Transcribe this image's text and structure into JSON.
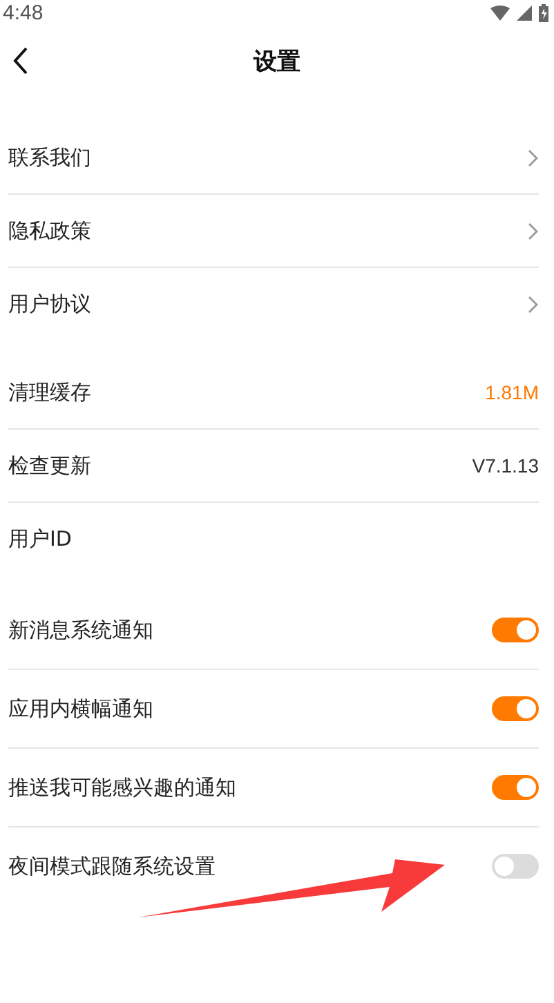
{
  "status_bar": {
    "time": "4:48"
  },
  "header": {
    "title": "设置"
  },
  "groups": [
    {
      "items": [
        {
          "kind": "link",
          "label": "联系我们"
        },
        {
          "kind": "link",
          "label": "隐私政策"
        },
        {
          "kind": "link",
          "label": "用户协议"
        }
      ]
    },
    {
      "items": [
        {
          "kind": "value",
          "label": "清理缓存",
          "value": "1.81M",
          "color": "#ff7a00"
        },
        {
          "kind": "value",
          "label": "检查更新",
          "value": "V7.1.13",
          "color": "#333333"
        },
        {
          "kind": "plain",
          "label": "用户ID"
        }
      ]
    },
    {
      "items": [
        {
          "kind": "toggle",
          "label": "新消息系统通知",
          "on": true
        },
        {
          "kind": "toggle",
          "label": "应用内横幅通知",
          "on": true
        },
        {
          "kind": "toggle",
          "label": "推送我可能感兴趣的通知",
          "on": true
        },
        {
          "kind": "toggle",
          "label": "夜间模式跟随系统设置",
          "on": false
        }
      ]
    }
  ]
}
